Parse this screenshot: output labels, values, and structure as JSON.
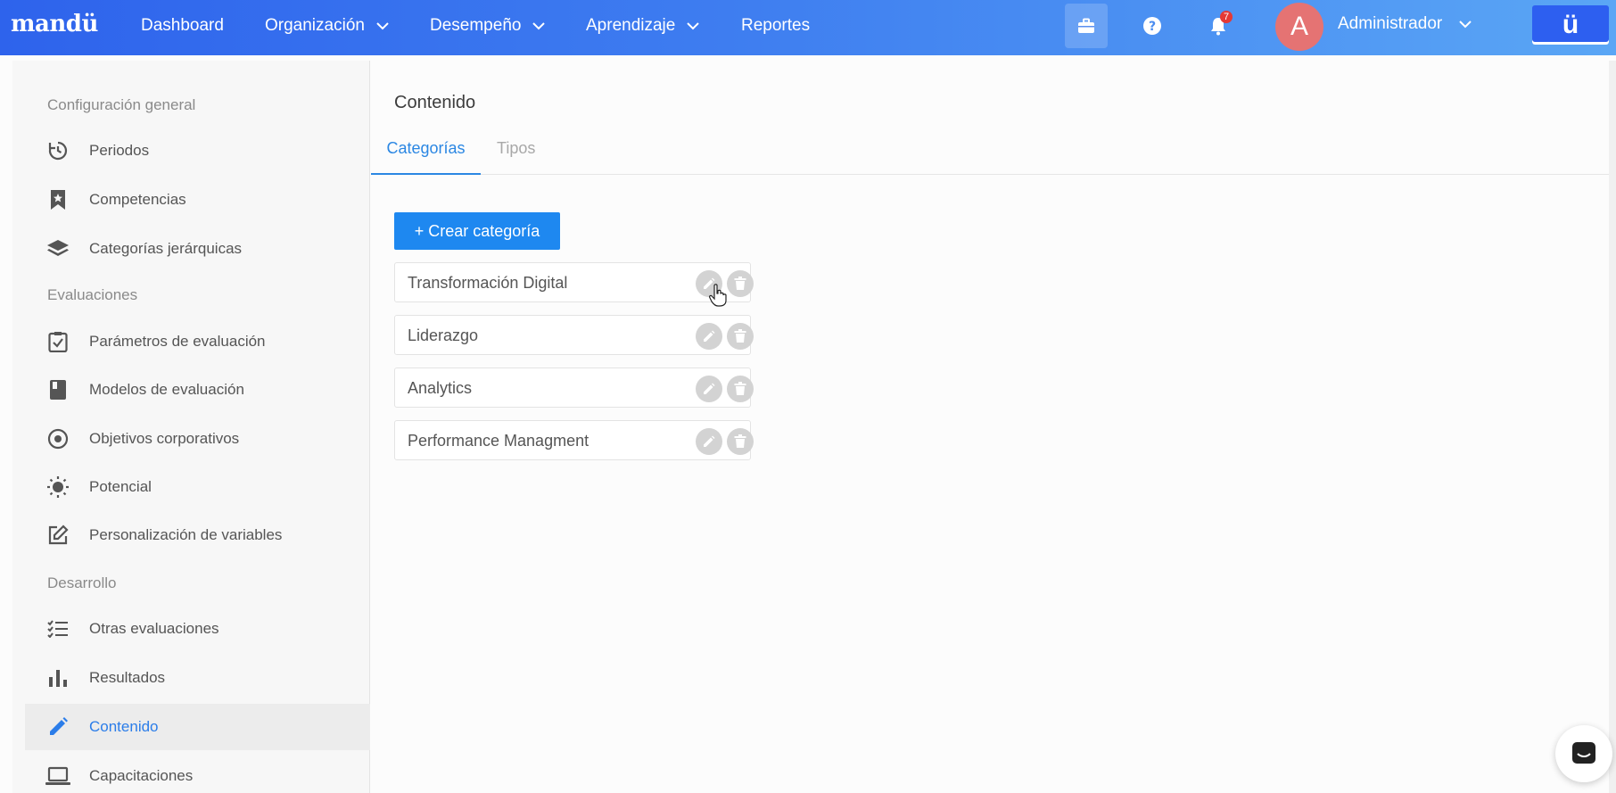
{
  "app": {
    "logo": "mandü"
  },
  "nav": {
    "items": [
      {
        "label": "Dashboard",
        "dropdown": false
      },
      {
        "label": "Organización",
        "dropdown": true
      },
      {
        "label": "Desempeño",
        "dropdown": true
      },
      {
        "label": "Aprendizaje",
        "dropdown": true
      },
      {
        "label": "Reportes",
        "dropdown": false
      }
    ],
    "notifications_count": "7",
    "avatar_initial": "A",
    "user_name": "Administrador",
    "brand_mark": "ü"
  },
  "sidebar": {
    "sections": [
      {
        "title": "Configuración general"
      },
      {
        "title": "Evaluaciones"
      },
      {
        "title": "Desarrollo"
      }
    ],
    "items": [
      {
        "label": "Periodos",
        "icon": "history-icon"
      },
      {
        "label": "Competencias",
        "icon": "bookmark-star-icon"
      },
      {
        "label": "Categorías jerárquicas",
        "icon": "layers-icon"
      },
      {
        "label": "Parámetros de evaluación",
        "icon": "clipboard-check-icon"
      },
      {
        "label": "Modelos de evaluación",
        "icon": "book-icon"
      },
      {
        "label": "Objetivos corporativos",
        "icon": "target-icon"
      },
      {
        "label": "Potencial",
        "icon": "sun-icon"
      },
      {
        "label": "Personalización de variables",
        "icon": "edit-square-icon"
      },
      {
        "label": "Otras evaluaciones",
        "icon": "checklist-icon"
      },
      {
        "label": "Resultados",
        "icon": "bar-chart-icon"
      },
      {
        "label": "Contenido",
        "icon": "pencil-icon",
        "active": true
      },
      {
        "label": "Capacitaciones",
        "icon": "laptop-icon"
      }
    ]
  },
  "main": {
    "title": "Contenido",
    "tabs": [
      {
        "label": "Categorías",
        "active": true
      },
      {
        "label": "Tipos",
        "active": false
      }
    ],
    "create_button": "+ Crear categoría",
    "categories": [
      "Transformación Digital",
      "Liderazgo",
      "Analytics",
      "Performance Managment"
    ]
  },
  "colors": {
    "accent": "#1e88f0",
    "active_text": "#2b7de9",
    "nav_gradient_start": "#2e63ec",
    "nav_gradient_end": "#5aa6f5"
  }
}
